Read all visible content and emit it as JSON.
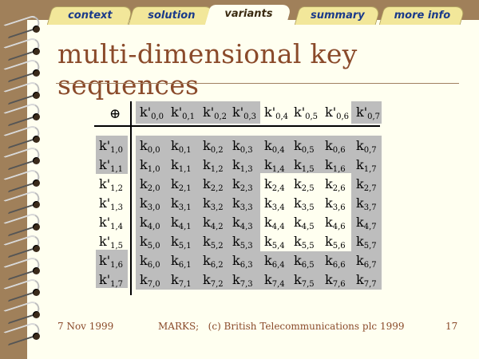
{
  "tabs": [
    {
      "label": "context",
      "active": false
    },
    {
      "label": "solution",
      "active": false
    },
    {
      "label": "variants",
      "active": true
    },
    {
      "label": "summary",
      "active": false
    },
    {
      "label": "more info",
      "active": false
    }
  ],
  "title": "multi-dimensional key sequences",
  "table": {
    "operator_symbol": "⊕",
    "column_headers": [
      "k'0,0",
      "k'0,1",
      "k'0,2",
      "k'0,3",
      "k'0,4",
      "k'0,5",
      "k'0,6",
      "k'0,7"
    ],
    "row_headers": [
      "k'1,0",
      "k'1,1",
      "k'1,2",
      "k'1,3",
      "k'1,4",
      "k'1,5",
      "k'1,6",
      "k'1,7"
    ],
    "cells": [
      [
        "k0,0",
        "k0,1",
        "k0,2",
        "k0,3",
        "k0,4",
        "k0,5",
        "k0,6",
        "k0,7"
      ],
      [
        "k1,0",
        "k1,1",
        "k1,2",
        "k1,3",
        "k1,4",
        "k1,5",
        "k1,6",
        "k1,7"
      ],
      [
        "k2,0",
        "k2,1",
        "k2,2",
        "k2,3",
        "k2,4",
        "k2,5",
        "k2,6",
        "k2,7"
      ],
      [
        "k3,0",
        "k3,1",
        "k3,2",
        "k3,3",
        "k3,4",
        "k3,5",
        "k3,6",
        "k3,7"
      ],
      [
        "k4,0",
        "k4,1",
        "k4,2",
        "k4,3",
        "k4,4",
        "k4,5",
        "k4,6",
        "k4,7"
      ],
      [
        "k5,0",
        "k5,1",
        "k5,2",
        "k5,3",
        "k5,4",
        "k5,5",
        "k5,6",
        "k5,7"
      ],
      [
        "k6,0",
        "k6,1",
        "k6,2",
        "k6,3",
        "k6,4",
        "k6,5",
        "k6,6",
        "k6,7"
      ],
      [
        "k7,0",
        "k7,1",
        "k7,2",
        "k7,3",
        "k7,4",
        "k7,5",
        "k7,6",
        "k7,7"
      ]
    ],
    "highlight_color": "#bdbdbd"
  },
  "footer": {
    "date": "7 Nov 1999",
    "credit": "MARKS;   (c) British Telecommunications plc 1999",
    "page_number": "17"
  },
  "colors": {
    "background": "#a0805a",
    "paper": "#fffff0",
    "tab": "#f2e79a",
    "tab_text": "#1a3a8a",
    "title": "#8a4a2a"
  }
}
